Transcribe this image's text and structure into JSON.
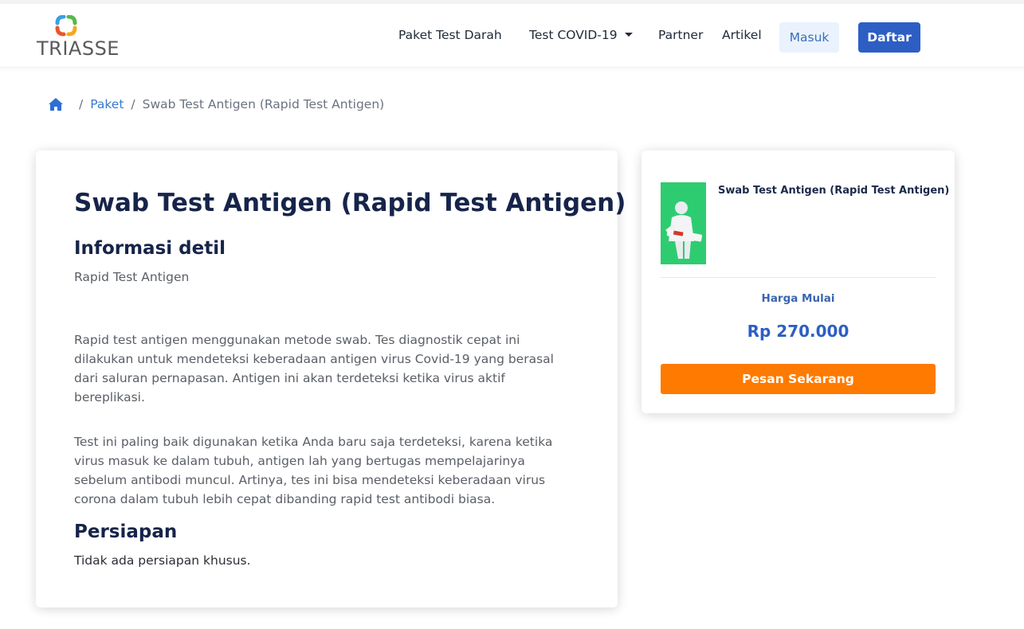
{
  "header": {
    "logo_text": "TRIASSE",
    "nav": {
      "paket_test_darah": "Paket Test Darah",
      "test_covid": "Test COVID-19",
      "partner": "Partner",
      "artikel": "Artikel"
    },
    "masuk_label": "Masuk",
    "daftar_label": "Daftar"
  },
  "breadcrumb": {
    "home_icon": "home-icon",
    "separator": "/",
    "paket": "Paket",
    "current": "Swab Test Antigen (Rapid Test Antigen)"
  },
  "main": {
    "title": "Swab Test Antigen (Rapid Test Antigen)",
    "info_heading": "Informasi detil",
    "info_subtitle": "Rapid Test Antigen",
    "paragraph1": "Rapid test antigen menggunakan metode swab. Tes diagnostik cepat ini dilakukan untuk mendeteksi keberadaan antigen virus Covid-19 yang berasal dari saluran pernapasan. Antigen ini akan terdeteksi ketika virus aktif bereplikasi.",
    "paragraph2": "Test ini paling baik digunakan ketika Anda baru saja terdeteksi, karena ketika virus masuk ke dalam tubuh, antigen lah yang bertugas mempelajarinya sebelum antibodi muncul. Artinya, tes ini bisa mendeteksi keberadaan virus corona dalam tubuh lebih cepat dibanding rapid test antibodi biasa.",
    "persiapan_heading": "Persiapan",
    "persiapan_text": "Tidak ada persiapan khusus."
  },
  "sidebar": {
    "product_title": "Swab Test Antigen (Rapid Test Antigen)",
    "price_label": "Harga Mulai",
    "price_value": "Rp 270.000",
    "order_button": "Pesan Sekarang"
  },
  "colors": {
    "primary": "#2d5ec4",
    "order_button": "#ff7a00",
    "heading": "#16244a",
    "thumbnail_bg": "#2ecc71"
  }
}
